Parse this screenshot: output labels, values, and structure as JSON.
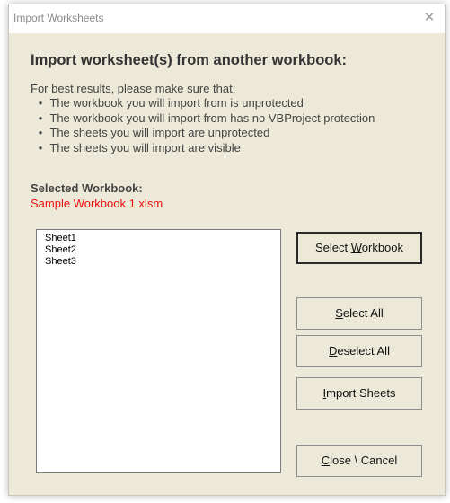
{
  "window": {
    "title": "Import Worksheets",
    "close_glyph": "✕"
  },
  "content": {
    "heading": "Import worksheet(s) from another workbook:",
    "intro": "For best results, please make sure that:",
    "bullet_glyph": "•",
    "bullets": [
      "The workbook you will import from is unprotected",
      "The workbook you will import from has no VBProject protection",
      "The sheets you will import are unprotected",
      "The sheets you will import are visible"
    ],
    "selected_label": "Selected Workbook:",
    "selected_value": "Sample Workbook 1.xlsm"
  },
  "sheets": [
    "Sheet1",
    "Sheet2",
    "Sheet3"
  ],
  "buttons": {
    "select_workbook": {
      "pre": "Select ",
      "key": "W",
      "post": "orkbook"
    },
    "select_all": {
      "pre": "",
      "key": "S",
      "post": "elect All"
    },
    "deselect_all": {
      "pre": "",
      "key": "D",
      "post": "eselect All"
    },
    "import_sheets": {
      "pre": "",
      "key": "I",
      "post": "mport Sheets"
    },
    "close_cancel": {
      "pre": "",
      "key": "C",
      "post": "lose \\ Cancel"
    }
  },
  "colors": {
    "dialog_bg": "#ece9d8",
    "selected_value": "#ee1111"
  }
}
